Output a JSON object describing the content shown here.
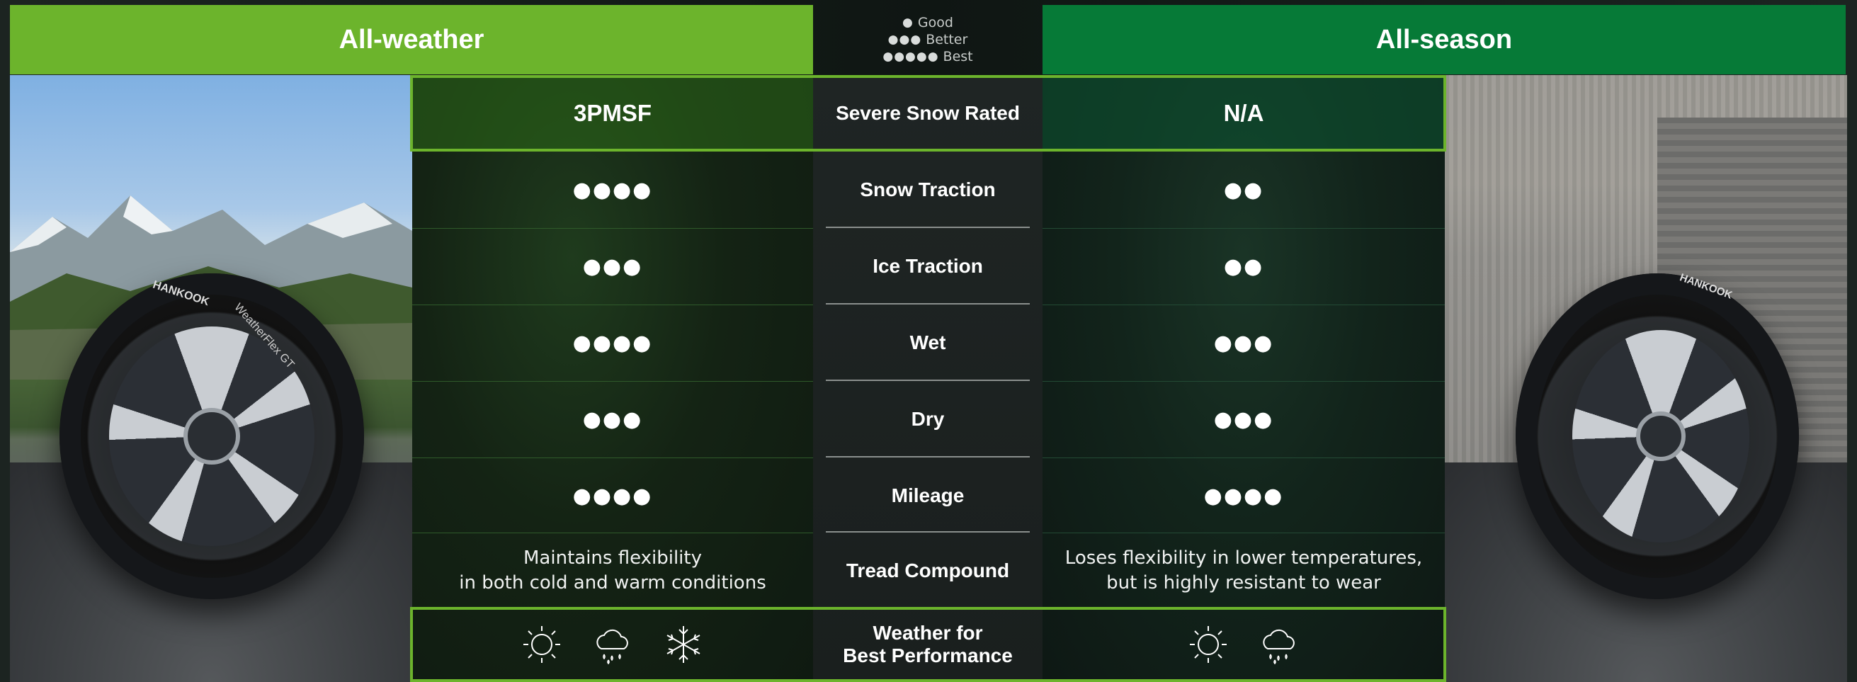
{
  "headers": {
    "left": "All-weather",
    "right": "All-season"
  },
  "legend": [
    {
      "dots": "●",
      "label": "Good"
    },
    {
      "dots": "●●●",
      "label": "Better"
    },
    {
      "dots": "●●●●●",
      "label": "Best"
    }
  ],
  "rows": [
    {
      "label": "Severe Snow Rated",
      "left": "3PMSF",
      "right": "N/A"
    },
    {
      "label": "Snow Traction",
      "left": "●●●●",
      "right": "●●"
    },
    {
      "label": "Ice Traction",
      "left": "●●●",
      "right": "●●"
    },
    {
      "label": "Wet",
      "left": "●●●●",
      "right": "●●●"
    },
    {
      "label": "Dry",
      "left": "●●●",
      "right": "●●●"
    },
    {
      "label": "Mileage",
      "left": "●●●●",
      "right": "●●●●"
    },
    {
      "label": "Tread Compound",
      "left_line1": "Maintains flexibility",
      "left_line2": "in both cold and warm conditions",
      "right_line1": "Loses flexibility in lower temperatures,",
      "right_line2": "but is highly resistant to wear"
    },
    {
      "label_line1": "Weather for",
      "label_line2": "Best Performance",
      "left_icons": [
        "sun-icon",
        "rain-cloud-icon",
        "snowflake-icon"
      ],
      "right_icons": [
        "sun-icon",
        "rain-cloud-icon"
      ]
    }
  ],
  "tire_left": {
    "brand": "HANKOOK",
    "model": "WeatherFlex GT"
  },
  "tire_right": {
    "brand": "HANKOOK"
  },
  "colors": {
    "all_weather": "#6cb42c",
    "all_season": "#067a37",
    "highlight": "#6cb42c"
  }
}
